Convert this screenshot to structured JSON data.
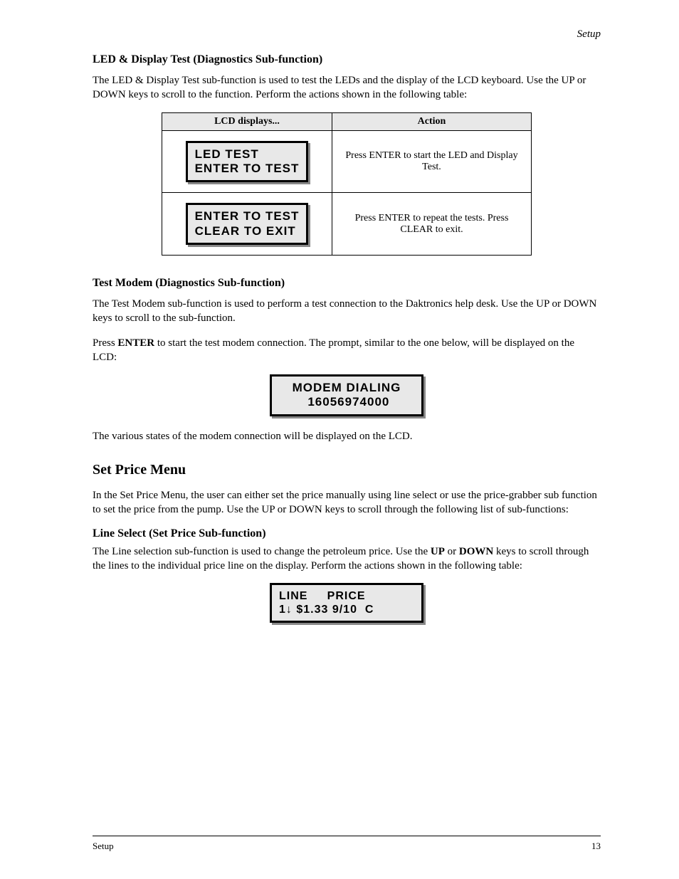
{
  "header": {
    "right": "Setup"
  },
  "section1": {
    "title": "LED & Display Test (Diagnostics Sub-function)",
    "para": "The LED & Display Test sub-function is used to test the LEDs and the display of the LCD keyboard. Use the UP or DOWN keys to scroll to the function. Perform the actions shown in the following table:"
  },
  "table": {
    "head_lcd": "LCD displays...",
    "head_action": "Action",
    "row1": {
      "lcd_l1": "LED TEST",
      "lcd_l2": "ENTER TO TEST",
      "action": "Press ENTER to start the LED and Display Test."
    },
    "row2": {
      "lcd_l1": "ENTER TO TEST",
      "lcd_l2": "CLEAR TO EXIT",
      "action": "Press ENTER to repeat the tests. Press CLEAR to exit."
    }
  },
  "section2": {
    "title": "Test Modem (Diagnostics Sub-function)",
    "para1": "The Test Modem sub-function is used to perform a test connection to the Daktronics help desk. Use the UP or DOWN keys to scroll to the sub-function.",
    "para2_a": "Press ",
    "para2_b": "ENTER",
    "para2_c": " to start the test modem connection. The prompt, similar to the one below, will be displayed on the LCD:",
    "lcd_l1": "MODEM DIALING",
    "lcd_l2": " 16056974000",
    "para3": "The various states of the modem connection will be displayed on the LCD."
  },
  "section3": {
    "heading": "Set Price Menu",
    "para": "In the Set Price Menu, the user can either set the price manually using line select or use the price-grabber sub function to set the price from the pump. Use the UP or DOWN keys to scroll through the following list of sub-functions:"
  },
  "section4": {
    "title": "Line Select (Set Price Sub-function)",
    "para_a": "The Line selection sub-function is used to change the petroleum price. Use the ",
    "para_b": "UP",
    "para_c": " or ",
    "para_d": "DOWN",
    "para_e": " keys to scroll through the lines to the individual price line on the display. Perform the actions shown in the following table:",
    "lcd_l1": "LINE     PRICE",
    "lcd_l2": "1↓ $1.33 9/10  C"
  },
  "footer": {
    "left": "Setup",
    "right": "13"
  }
}
